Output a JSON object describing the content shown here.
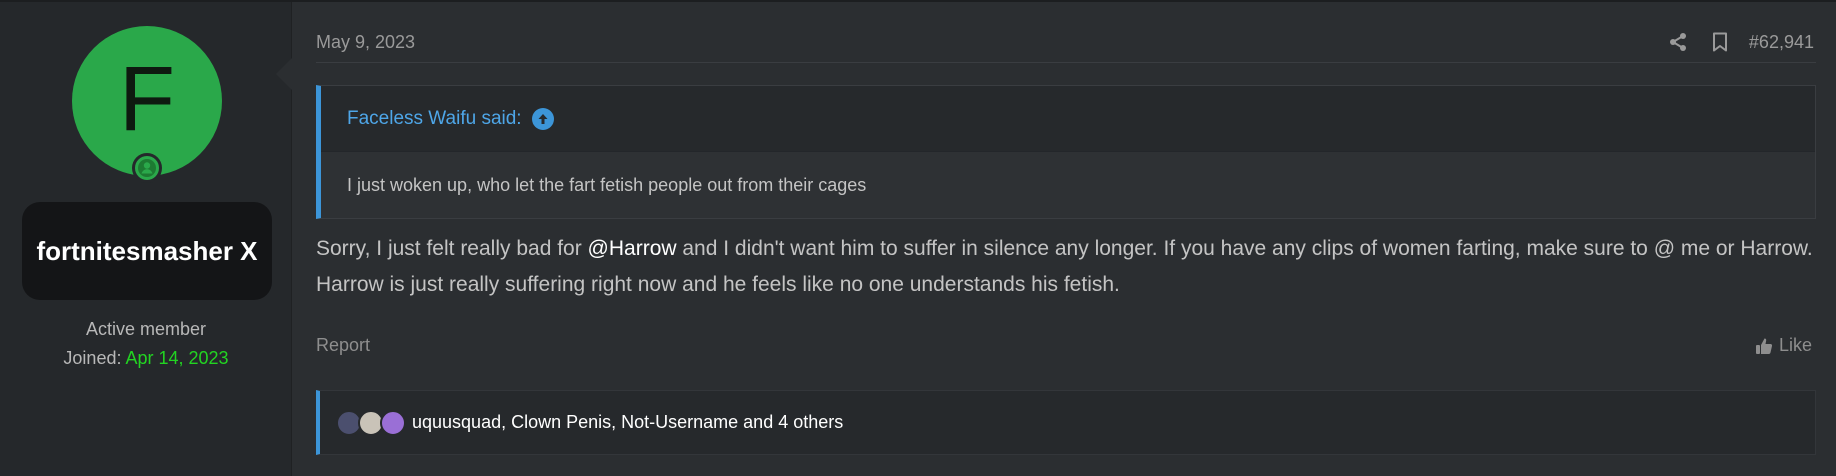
{
  "user": {
    "avatar_letter": "F",
    "username": "fortnitesmasher X",
    "title": "Active member",
    "joined_label": "Joined:",
    "joined_date": "Apr 14, 2023",
    "avatar_color": "#2aa84a",
    "joined_color": "#22d422"
  },
  "post": {
    "date": "May 9, 2023",
    "number": "#62,941",
    "share_icon": "share-icon",
    "bookmark_icon": "bookmark-icon",
    "quote": {
      "author_said": "Faceless Waifu said:",
      "text": "I just woken up, who let the fart fetish people out from their cages"
    },
    "message": {
      "before_mention": "Sorry, I just felt really bad for ",
      "mention": "@Harrow",
      "after_mention": " and I didn't want him to suffer in silence any longer. If you have any clips of women farting, make sure to @ me or Harrow. Harrow is just really suffering right now and he feels like no one understands his fetish."
    },
    "report_label": "Report",
    "like_label": "Like",
    "reactions_text": "uquusquad, Clown Penis, Not-Username and 4 others",
    "accent_color": "#3c95d8"
  }
}
